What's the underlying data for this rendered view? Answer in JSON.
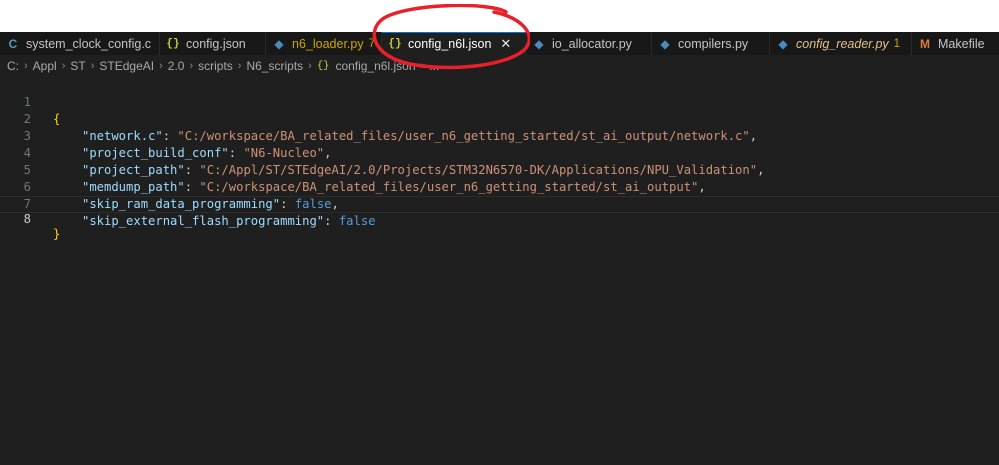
{
  "tabs": [
    {
      "icon": "c-file-icon",
      "glyph": "C",
      "label": "system_clock_config.c",
      "modified": "",
      "active": false
    },
    {
      "icon": "json-icon",
      "glyph": "{}",
      "label": "config.json",
      "modified": "",
      "active": false
    },
    {
      "icon": "python-icon",
      "glyph": "◆",
      "label": "n6_loader.py",
      "modified": "7",
      "active": false
    },
    {
      "icon": "json-icon",
      "glyph": "{}",
      "label": "config_n6l.json",
      "modified": "",
      "active": true,
      "close": "✕"
    },
    {
      "icon": "python-icon",
      "glyph": "◆",
      "label": "io_allocator.py",
      "modified": "",
      "active": false
    },
    {
      "icon": "python-icon",
      "glyph": "◆",
      "label": "compilers.py",
      "modified": "",
      "active": false
    },
    {
      "icon": "python-icon",
      "glyph": "◆",
      "label": "config_reader.py",
      "modified": "1",
      "active": false
    },
    {
      "icon": "makefile-icon",
      "glyph": "M",
      "label": "Makefile",
      "modified": "",
      "active": false
    }
  ],
  "breadcrumb": {
    "segments": [
      "C:",
      "Appl",
      "ST",
      "STEdgeAI",
      "2.0",
      "scripts",
      "N6_scripts"
    ],
    "file_icon": "{}",
    "file": "config_n6l.json",
    "tail": "..."
  },
  "editor": {
    "line_numbers": [
      "1",
      "2",
      "3",
      "4",
      "5",
      "6",
      "7",
      "8"
    ],
    "open_brace": "{",
    "close_brace": "}",
    "entries": [
      {
        "key": "\"network.c\"",
        "value": "\"C:/workspace/BA_related_files/user_n6_getting_started/st_ai_output/network.c\"",
        "comma": ","
      },
      {
        "key": "\"project_build_conf\"",
        "value": "\"N6-Nucleo\"",
        "comma": ","
      },
      {
        "key": "\"project_path\"",
        "value": "\"C:/Appl/ST/STEdgeAI/2.0/Projects/STM32N6570-DK/Applications/NPU_Validation\"",
        "comma": ","
      },
      {
        "key": "\"memdump_path\"",
        "value": "\"C:/workspace/BA_related_files/user_n6_getting_started/st_ai_output\"",
        "comma": ","
      },
      {
        "key": "\"skip_ram_data_programming\"",
        "value": "false",
        "comma": ","
      },
      {
        "key": "\"skip_external_flash_programming\"",
        "value": "false",
        "comma": ""
      }
    ]
  },
  "colors": {
    "annotation": "#e8202a",
    "active_tab_border": "#0078d4",
    "editor_bg": "#1f1f1f"
  }
}
